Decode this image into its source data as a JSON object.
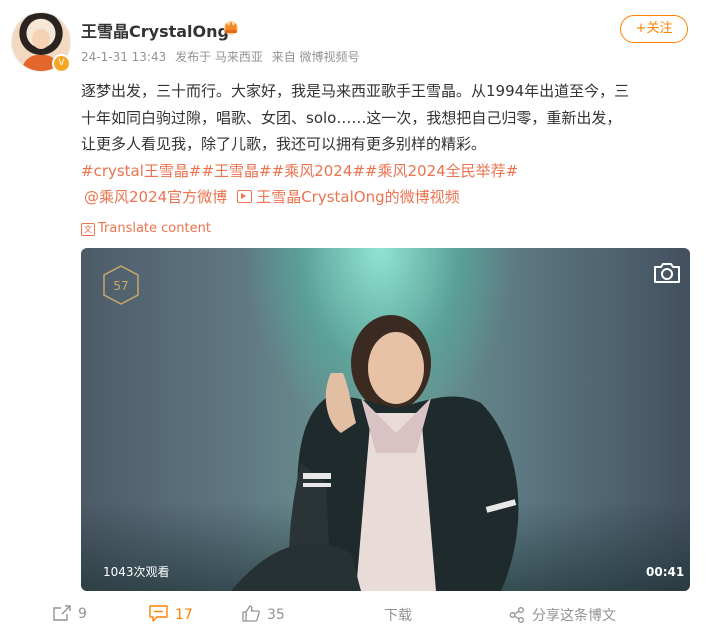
{
  "author": {
    "name": "王雪晶CrystalOng",
    "verified_badge": "V",
    "crown_color": "#f5a623"
  },
  "meta": {
    "timestamp": "24-1-31 13:43",
    "location": "发布于 马来西亚",
    "source": "来自 微博视频号"
  },
  "follow_label": "+关注",
  "content": {
    "line1": "逐梦出发，三十而行。大家好，我是马来西亚歌手王雪晶。从1994年出道至今，三",
    "line2": "十年如同白驹过隙，唱歌、女团、solo……这一次，我想把自己归零，重新出发，",
    "line3": "让更多人看见我，除了儿歌，我还可以拥有更多别样的精彩。",
    "tags": "#crystal王雪晶##王雪晶##乘风2024##乘风2024全民举荐#",
    "mention": "@乘风2024官方微博",
    "video_link": "王雪晶CrystalOng的微博视频",
    "translate": "Translate content"
  },
  "video": {
    "views": "1043次观看",
    "duration": "00:41",
    "logo_text": "57"
  },
  "actions": {
    "forward": "9",
    "comment": "17",
    "like": "35",
    "download": "下载",
    "share": "分享这条博文"
  },
  "colors": {
    "accent": "#ff8200",
    "link": "#eb7350",
    "muted": "#939393"
  }
}
